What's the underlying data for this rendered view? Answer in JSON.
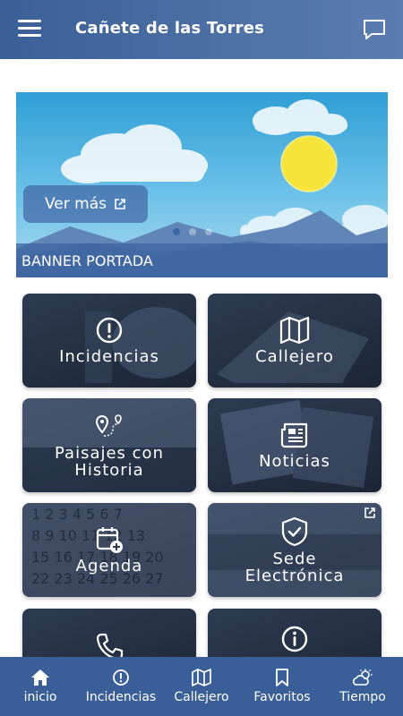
{
  "header": {
    "title": "Cañete de las Torres"
  },
  "banner": {
    "button_label": "Ver más",
    "caption": "BANNER PORTADA",
    "slides": 3,
    "active_slide": 1
  },
  "tiles": [
    {
      "label": "Incidencias"
    },
    {
      "label": "Callejero"
    },
    {
      "label": "Paisajes con Historia"
    },
    {
      "label": "Noticias"
    },
    {
      "label": "Agenda"
    },
    {
      "label": "Sede Electrónica"
    },
    {
      "label": ""
    },
    {
      "label": ""
    }
  ],
  "nav": {
    "items": [
      {
        "label": "inicio"
      },
      {
        "label": "Incidencias"
      },
      {
        "label": "Callejero"
      },
      {
        "label": "Favoritos"
      },
      {
        "label": "Tiempo"
      }
    ]
  },
  "colors": {
    "header": "#3b5f97",
    "nav": "#3a5f98",
    "tile": "#1f2a3c",
    "sun": "#f7e43b"
  }
}
